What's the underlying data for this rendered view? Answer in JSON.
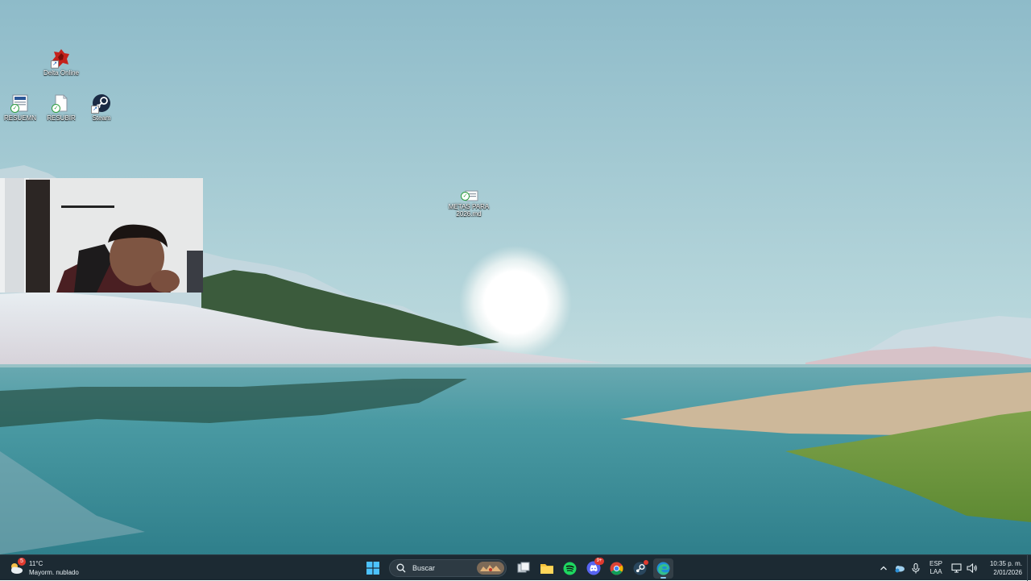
{
  "desktop": {
    "icons": [
      {
        "label": "Delta Online",
        "icon": "red-game-icon"
      },
      {
        "label": "RESUEMN",
        "icon": "document-synced-icon"
      },
      {
        "label": "RESUBIR",
        "icon": "text-file-synced-icon"
      },
      {
        "label": "Steam",
        "icon": "steam-icon"
      },
      {
        "label": "METAS PARA\n2026.md",
        "icon": "markdown-file-synced-icon"
      }
    ]
  },
  "taskbar": {
    "weather": {
      "temp": "11°C",
      "desc": "Mayorm. nublado",
      "badge": "5"
    },
    "search": {
      "placeholder": "Buscar"
    },
    "apps": [
      {
        "name": "start",
        "icon": "windows-start-icon"
      },
      {
        "name": "task-view",
        "icon": "task-view-icon"
      },
      {
        "name": "file-explorer",
        "icon": "folder-icon"
      },
      {
        "name": "spotify",
        "icon": "spotify-icon"
      },
      {
        "name": "discord",
        "icon": "discord-icon",
        "badge": "9+"
      },
      {
        "name": "chrome",
        "icon": "chrome-icon"
      },
      {
        "name": "steam",
        "icon": "steam-icon"
      },
      {
        "name": "edge",
        "icon": "edge-icon"
      }
    ],
    "tray": {
      "lang_top": "ESP",
      "lang_bottom": "LAA",
      "time": "10:35 p. m.",
      "date": "2/01/2026"
    }
  },
  "colors": {
    "taskbar_bg": "#1c2a33",
    "sky_top": "#8fbccb",
    "water": "#3f8d96",
    "accent": "#8cc8f0"
  }
}
